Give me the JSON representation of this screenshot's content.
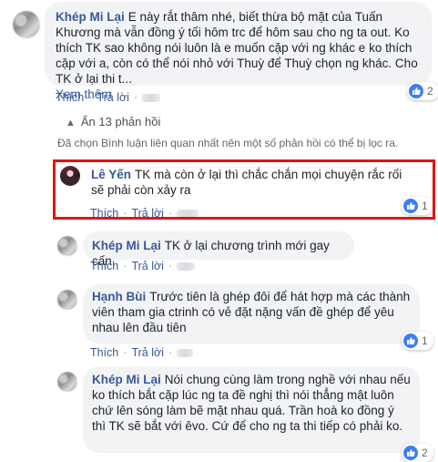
{
  "ui": {
    "like": "Thích",
    "reply": "Trả lời",
    "dot": "·"
  },
  "comments": [
    {
      "author": "Khép Mi Lại",
      "text": "E này rắt thâm nhé, biết thừa bộ mặt của Tuấn Khương mà vẫn đồng ý tối hôm trc để hôm sau cho ng ta out. Ko thích TK sao không nói luôn là e muốn cặp với ng khác e ko thích cặp với a, còn có thể nói nhỏ với Thuỳ để Thuỳ chọn ng khác. Cho TK ở lại thi t...",
      "more": "Xem thêm",
      "reactions": "2"
    },
    {
      "author": "Lê Yến",
      "text": "TK mà còn ở lại thì chắc chắn mọi chuyện rắc rối sẽ phải còn xảy ra",
      "reactions": "1"
    },
    {
      "author": "Khép Mi Lại",
      "text": "TK ở lại chương trình mới gay cấn."
    },
    {
      "author": "Hạnh Bùi",
      "text": "Trước tiên là ghép đôi để hát hợp mà các thành viên tham gia ctrinh có vẻ đặt nặng vấn đề ghép để yêu nhau lên đầu tiên",
      "reactions": "1"
    },
    {
      "author": "Khép Mi Lại",
      "text": "Nói chung cùng làm trong nghề với nhau nếu ko thích bắt cặp lúc ng ta đề nghị thì nói thẳng mật luôn chứ lên sóng làm bẽ mặt nhau quá. Trần hoà ko đồng ý thì TK sẽ bắt với êvo. Cứ để cho ng ta thi tiếp có phải ko.",
      "reactions": "2"
    }
  ],
  "replies_toggle": "Ẩn 13 phản hồi",
  "filter_note": "Đã chọn Bình luận liên quan nhất nên một số phản hồi có thể bị lọc ra.",
  "colors": {
    "link": "#385898",
    "bubble": "#f2f3f5",
    "like": "#3b7ef4",
    "highlight": "#e11313"
  },
  "icons": {
    "like": "thumbs-up-icon",
    "collapse": "chevron-up-icon"
  }
}
